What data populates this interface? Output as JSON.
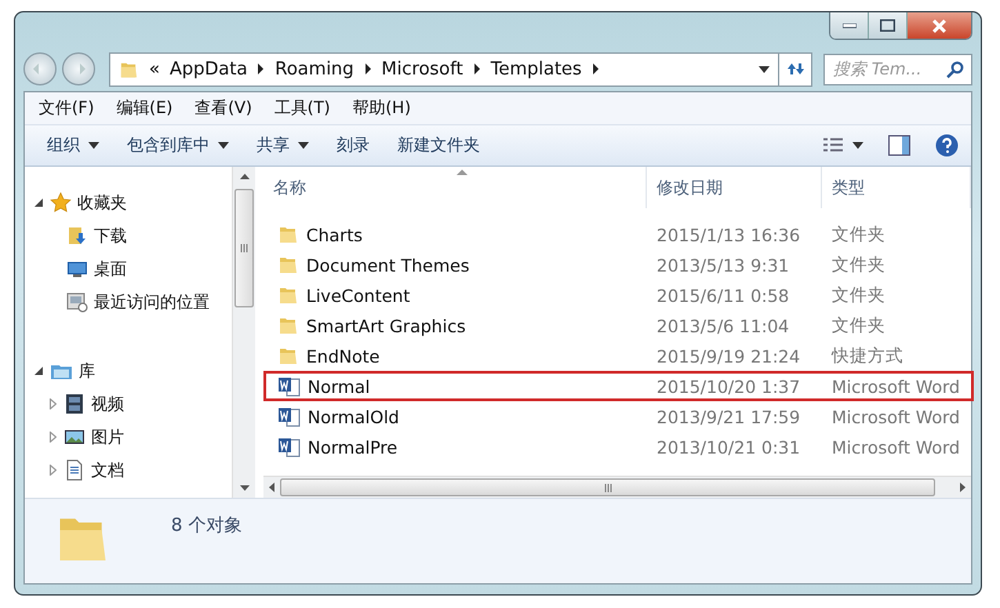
{
  "address": {
    "overflow": "«",
    "crumbs": [
      "AppData",
      "Roaming",
      "Microsoft",
      "Templates"
    ]
  },
  "search": {
    "placeholder": "搜索 Tem..."
  },
  "menu": [
    "文件(F)",
    "编辑(E)",
    "查看(V)",
    "工具(T)",
    "帮助(H)"
  ],
  "toolbar": [
    {
      "label": "组织",
      "dropdown": true
    },
    {
      "label": "包含到库中",
      "dropdown": true
    },
    {
      "label": "共享",
      "dropdown": true
    },
    {
      "label": "刻录",
      "dropdown": false
    },
    {
      "label": "新建文件夹",
      "dropdown": false
    }
  ],
  "nav": [
    {
      "label": "收藏夹",
      "kind": "favorites",
      "expanded": true,
      "children": [
        {
          "label": "下载",
          "kind": "download"
        },
        {
          "label": "桌面",
          "kind": "desktop"
        },
        {
          "label": "最近访问的位置",
          "kind": "recent"
        }
      ]
    },
    {
      "label": "库",
      "kind": "library",
      "expanded": true,
      "children": [
        {
          "label": "视频",
          "kind": "video",
          "expanded": false
        },
        {
          "label": "图片",
          "kind": "pictures",
          "expanded": false
        },
        {
          "label": "文档",
          "kind": "documents",
          "expanded": false
        }
      ]
    }
  ],
  "table": {
    "columns": [
      "名称",
      "修改日期",
      "类型"
    ],
    "rows": [
      {
        "name": "Charts",
        "date": "2015/1/13 16:36",
        "type": "文件夹",
        "kind": "folder",
        "highlighted": false
      },
      {
        "name": "Document Themes",
        "date": "2013/5/13 9:31",
        "type": "文件夹",
        "kind": "folder",
        "highlighted": false
      },
      {
        "name": "LiveContent",
        "date": "2015/6/11 0:58",
        "type": "文件夹",
        "kind": "folder",
        "highlighted": false
      },
      {
        "name": "SmartArt Graphics",
        "date": "2013/5/6 11:04",
        "type": "文件夹",
        "kind": "folder",
        "highlighted": false
      },
      {
        "name": "EndNote",
        "date": "2015/9/19 21:24",
        "type": "快捷方式",
        "kind": "shortcut",
        "highlighted": false
      },
      {
        "name": "Normal",
        "date": "2015/10/20 1:37",
        "type": "Microsoft Word",
        "kind": "document",
        "highlighted": true
      },
      {
        "name": "NormalOld",
        "date": "2013/9/21 17:59",
        "type": "Microsoft Word",
        "kind": "document",
        "highlighted": false
      },
      {
        "name": "NormalPre",
        "date": "2013/10/21 0:31",
        "type": "Microsoft Word",
        "kind": "document",
        "highlighted": false
      }
    ]
  },
  "status_bar": {
    "text": "8 个对象"
  }
}
